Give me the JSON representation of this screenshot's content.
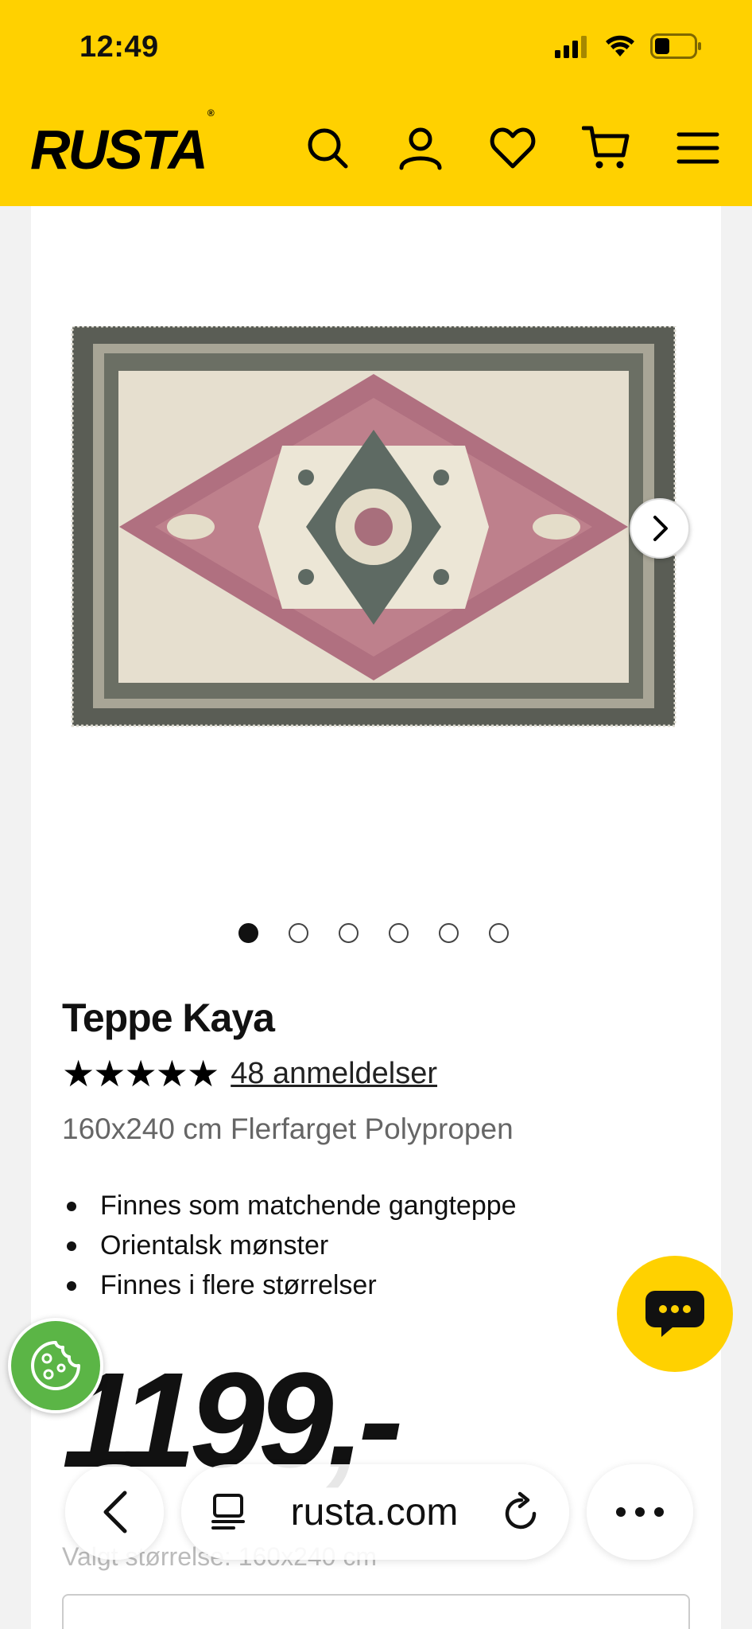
{
  "status": {
    "time": "12:49"
  },
  "header": {
    "logo": "RUSTA",
    "logo_mark": "®"
  },
  "product": {
    "title": "Teppe Kaya",
    "stars": "★★★★★",
    "reviews_link": "48 anmeldelser",
    "subtitle": "160x240 cm Flerfarget Polypropen",
    "features": [
      "Finnes som matchende gangteppe",
      "Orientalsk mønster",
      "Finnes i flere størrelser"
    ],
    "price": "1199,-",
    "size_label": "Valgt størrelse: 160x240 cm",
    "image_count": 6,
    "active_image": 1
  },
  "browser": {
    "url": "rusta.com"
  },
  "colors": {
    "brand_yellow": "#ffd100",
    "cookie_green": "#5bb546"
  },
  "icons": [
    "search-icon",
    "account-icon",
    "heart-icon",
    "cart-icon",
    "menu-icon",
    "chevron-right-icon",
    "chat-icon",
    "cookie-icon",
    "back-icon",
    "reader-icon",
    "reload-icon",
    "more-icon"
  ]
}
